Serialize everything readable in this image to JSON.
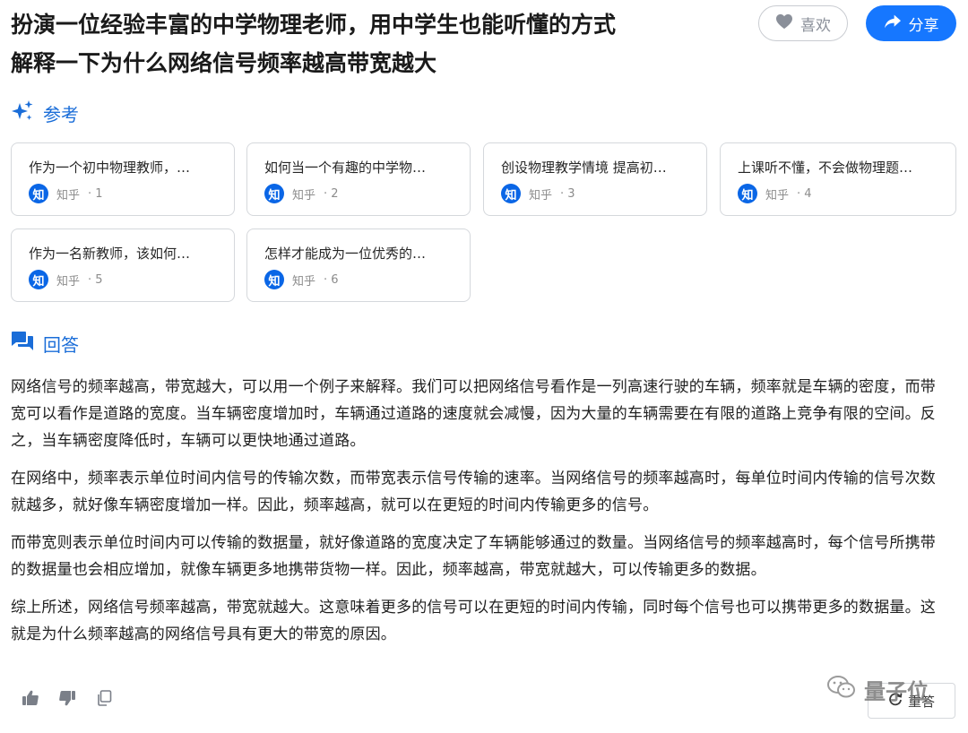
{
  "question": {
    "title_line1": "扮演一位经验丰富的中学物理老师，用中学生也能听懂的方式",
    "title_line2": "解释一下为什么网络信号频率越高带宽越大"
  },
  "actions": {
    "like_label": "喜欢",
    "share_label": "分享",
    "like_icon": "heart-icon",
    "share_icon": "share-arrow-icon"
  },
  "references": {
    "heading": "参考",
    "icon": "sparkle-icon",
    "items": [
      {
        "title": "作为一个初中物理教师，…",
        "source": "知乎",
        "index": "· 1",
        "logo": "知"
      },
      {
        "title": "如何当一个有趣的中学物…",
        "source": "知乎",
        "index": "· 2",
        "logo": "知"
      },
      {
        "title": "创设物理教学情境 提高初…",
        "source": "知乎",
        "index": "· 3",
        "logo": "知"
      },
      {
        "title": "上课听不懂，不会做物理题…",
        "source": "知乎",
        "index": "· 4",
        "logo": "知"
      },
      {
        "title": "作为一名新教师，该如何…",
        "source": "知乎",
        "index": "· 5",
        "logo": "知"
      },
      {
        "title": "怎样才能成为一位优秀的…",
        "source": "知乎",
        "index": "· 6",
        "logo": "知"
      }
    ]
  },
  "answer": {
    "heading": "回答",
    "icon": "chat-bubbles-icon",
    "paragraphs": [
      "网络信号的频率越高，带宽越大，可以用一个例子来解释。我们可以把网络信号看作是一列高速行驶的车辆，频率就是车辆的密度，而带宽可以看作是道路的宽度。当车辆密度增加时，车辆通过道路的速度就会减慢，因为大量的车辆需要在有限的道路上竞争有限的空间。反之，当车辆密度降低时，车辆可以更快地通过道路。",
      "在网络中，频率表示单位时间内信号的传输次数，而带宽表示信号传输的速率。当网络信号的频率越高时，每单位时间内传输的信号次数就越多，就好像车辆密度增加一样。因此，频率越高，就可以在更短的时间内传输更多的信号。",
      "而带宽则表示单位时间内可以传输的数据量，就好像道路的宽度决定了车辆能够通过的数量。当网络信号的频率越高时，每个信号所携带的数据量也会相应增加，就像车辆更多地携带货物一样。因此，频率越高，带宽就越大，可以传输更多的数据。",
      "综上所述，网络信号频率越高，带宽就越大。这意味着更多的信号可以在更短的时间内传输，同时每个信号也可以携带更多的数据量。这就是为什么频率越高的网络信号具有更大的带宽的原因。"
    ]
  },
  "footer": {
    "report_label": "重答",
    "watermark_text": "量子位",
    "icons": [
      "thumbs-up-icon",
      "thumbs-down-icon",
      "copy-icon"
    ]
  }
}
